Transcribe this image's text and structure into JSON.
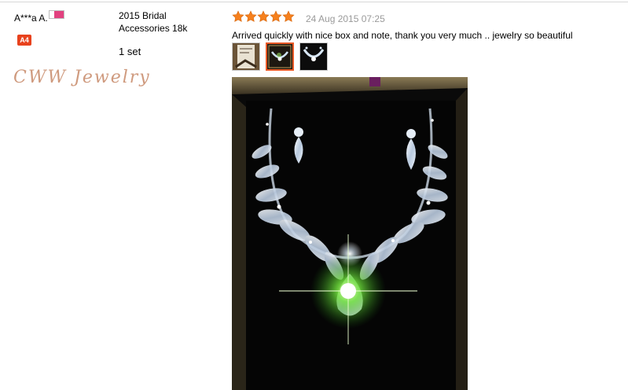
{
  "buyer": {
    "name": "A***a A.",
    "level": "A4"
  },
  "watermark": "CWW Jewelry",
  "product": {
    "name": "2015 Bridal Accessories 18k",
    "quantity": "1 set"
  },
  "review": {
    "rating": 5,
    "date": "24 Aug 2015 07:25",
    "text": "Arrived quickly with nice box and note, thank you very much .. jewelry so beautiful",
    "thumbnails": [
      {
        "name": "review-photo-thumbnail-1",
        "active": false
      },
      {
        "name": "review-photo-thumbnail-2",
        "active": true
      },
      {
        "name": "review-photo-thumbnail-3",
        "active": false
      }
    ]
  },
  "colors": {
    "star": "#f6801d",
    "badge": "#e8421d",
    "watermark": "#cf9a7e",
    "date": "#9a9a9a",
    "active_thumb_border": "#e95a27"
  },
  "icons": {
    "flag": "country-flag-icon",
    "star": "star-icon"
  }
}
